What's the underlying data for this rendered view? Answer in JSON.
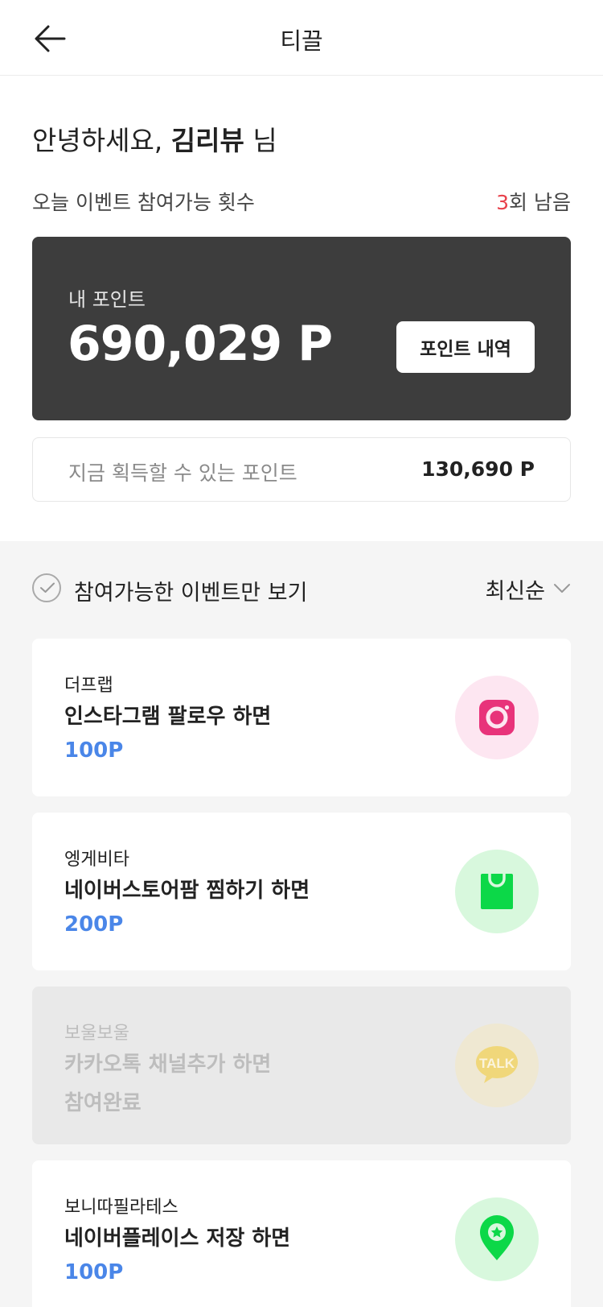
{
  "header": {
    "title": "티끌"
  },
  "greeting": {
    "prefix": "안녕하세요,",
    "name": "김리뷰",
    "suffix": "님"
  },
  "today": {
    "label": "오늘 이벤트 참여가능 횟수",
    "count": "3",
    "unit": "회 남음"
  },
  "points": {
    "label": "내 포인트",
    "value": "690,029 P",
    "history_button": "포인트 내역"
  },
  "earnable": {
    "label": "지금 획득할 수 있는 포인트",
    "value": "130,690 P"
  },
  "filter": {
    "label": "참여가능한 이벤트만 보기",
    "sort": "최신순"
  },
  "events": [
    {
      "brand": "더프랩",
      "title": "인스타그램 팔로우 하면",
      "reward": "100P",
      "icon": "instagram-icon",
      "status": "available"
    },
    {
      "brand": "엥게비타",
      "title": "네이버스토어팜 찜하기 하면",
      "reward": "200P",
      "icon": "shopping-bag-icon",
      "status": "available"
    },
    {
      "brand": "보울보울",
      "title": "카카오톡 채널추가 하면",
      "reward": "참여완료",
      "icon": "kakao-talk-icon",
      "status": "done"
    },
    {
      "brand": "보니따필라테스",
      "title": "네이버플레이스 저장 하면",
      "reward": "100P",
      "icon": "map-pin-star-icon",
      "status": "available"
    }
  ],
  "icon_labels": {
    "kakao_talk": "TALK"
  },
  "colors": {
    "accent_blue": "#4a86e8",
    "count_red": "#e8414b",
    "point_card_bg": "#3d3d3d",
    "instagram": "#e8337a",
    "naver_green": "#0cd848"
  }
}
